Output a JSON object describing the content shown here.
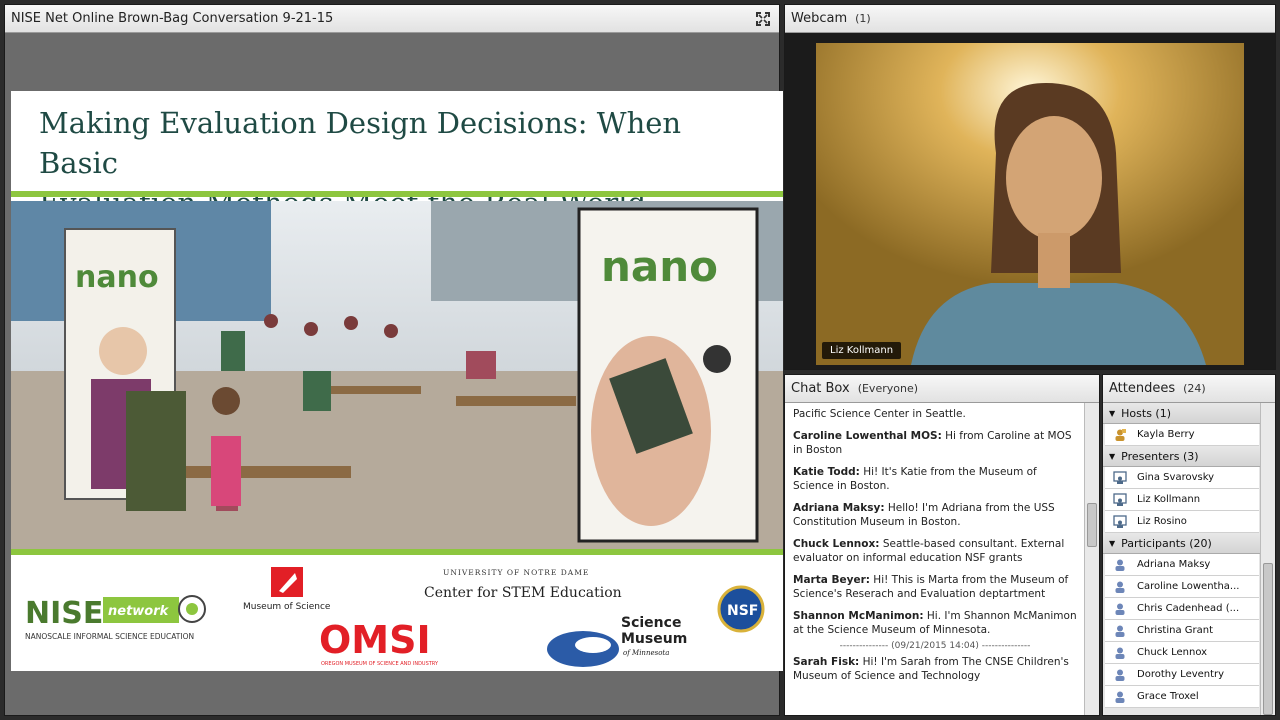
{
  "share": {
    "title": "NISE Net Online Brown-Bag Conversation 9-21-15",
    "slide": {
      "heading_line1": "Making Evaluation Design Decisions: When Basic",
      "heading_line2": "Evaluation Methods Meet the Real World",
      "banner_left": "nano",
      "banner_right": "nano",
      "logos": {
        "nise_main": "NISE",
        "nise_network": "network",
        "nise_sub": "NANOSCALE INFORMAL SCIENCE EDUCATION",
        "mos": "Museum of Science",
        "notre_dame_top": "UNIVERSITY OF NOTRE DAME",
        "notre_dame_main": "Center for STEM Education",
        "omsi": "OMSI",
        "omsi_sub": "OREGON MUSEUM OF SCIENCE AND INDUSTRY",
        "smm_line1": "Science",
        "smm_line2": "Museum",
        "smm_line3": "of Minnesota",
        "nsf": "NSF"
      }
    }
  },
  "webcam": {
    "title": "Webcam",
    "count": "(1)",
    "name_tag": "Liz Kollmann"
  },
  "chat": {
    "title": "Chat Box",
    "scope": "(Everyone)",
    "messages": [
      {
        "sender": "",
        "text": "Pacific Science Center in Seattle."
      },
      {
        "sender": "Caroline Lowenthal MOS:",
        "text": "Hi from Caroline at MOS in Boston"
      },
      {
        "sender": "Katie Todd:",
        "text": "Hi! It's Katie from the Museum of Science in Boston."
      },
      {
        "sender": "Adriana Maksy:",
        "text": "Hello! I'm Adriana from the USS Constitution Museum in Boston."
      },
      {
        "sender": "Chuck Lennox:",
        "text": "Seattle-based consultant. External evaluator on informal education NSF grants"
      },
      {
        "sender": "Marta Beyer:",
        "text": "Hi! This is Marta from the Museum of Science's Reserach and Evaluation deptartment"
      },
      {
        "sender": "Shannon McManimon:",
        "text": "Hi. I'm Shannon McManimon at the Science Museum of Minnesota."
      },
      {
        "sender": "Sarah Fisk:",
        "text": "Hi! I'm Sarah from The CNSE Children's Museum of Science and Technology"
      }
    ],
    "timestamp": "--------------- (09/21/2015 14:04) ---------------"
  },
  "attendees": {
    "title": "Attendees",
    "count": "(24)",
    "hosts_label": "Hosts (1)",
    "hosts": [
      "Kayla Berry"
    ],
    "presenters_label": "Presenters (3)",
    "presenters": [
      "Gina Svarovsky",
      "Liz Kollmann",
      "Liz Rosino"
    ],
    "participants_label": "Participants (20)",
    "participants": [
      "Adriana Maksy",
      "Caroline Lowentha...",
      "Chris Cadenhead (...",
      "Christina Grant",
      "Chuck Lennox",
      "Dorothy Leventry",
      "Grace Troxel"
    ]
  },
  "colors": {
    "slide_title": "#1f4a44",
    "nise_green": "#8dc63f",
    "omsi_red": "#e21f26",
    "smm_blue": "#2b5ba7"
  }
}
